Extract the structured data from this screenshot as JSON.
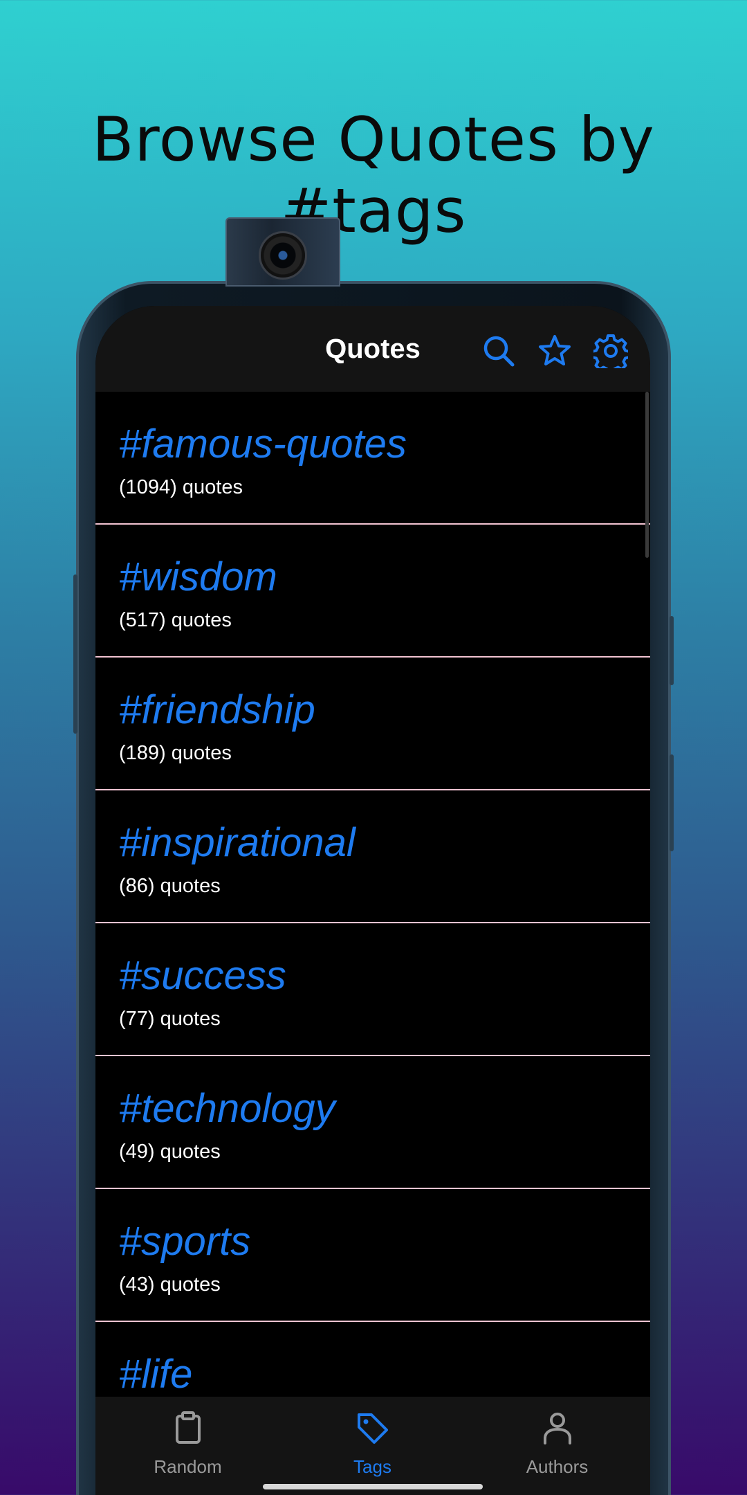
{
  "promo": {
    "title": "Browse Quotes by #tags"
  },
  "app_bar": {
    "title": "Quotes",
    "icons": [
      "search-icon",
      "star-icon",
      "gear-icon"
    ]
  },
  "tags": [
    {
      "name": "#famous-quotes",
      "count": "(1094) quotes"
    },
    {
      "name": "#wisdom",
      "count": "(517) quotes"
    },
    {
      "name": "#friendship",
      "count": "(189) quotes"
    },
    {
      "name": "#inspirational",
      "count": "(86) quotes"
    },
    {
      "name": "#success",
      "count": "(77) quotes"
    },
    {
      "name": "#technology",
      "count": "(49) quotes"
    },
    {
      "name": "#sports",
      "count": "(43) quotes"
    },
    {
      "name": "#life",
      "count": ""
    }
  ],
  "bottom_nav": {
    "items": [
      {
        "label": "Random",
        "icon": "clipboard-icon",
        "active": false
      },
      {
        "label": "Tags",
        "icon": "tag-icon",
        "active": true
      },
      {
        "label": "Authors",
        "icon": "person-icon",
        "active": false
      }
    ]
  },
  "colors": {
    "accent": "#1e7bf0",
    "divider": "#f2c4d2",
    "app_bar": "#141414",
    "background": "#000000"
  }
}
